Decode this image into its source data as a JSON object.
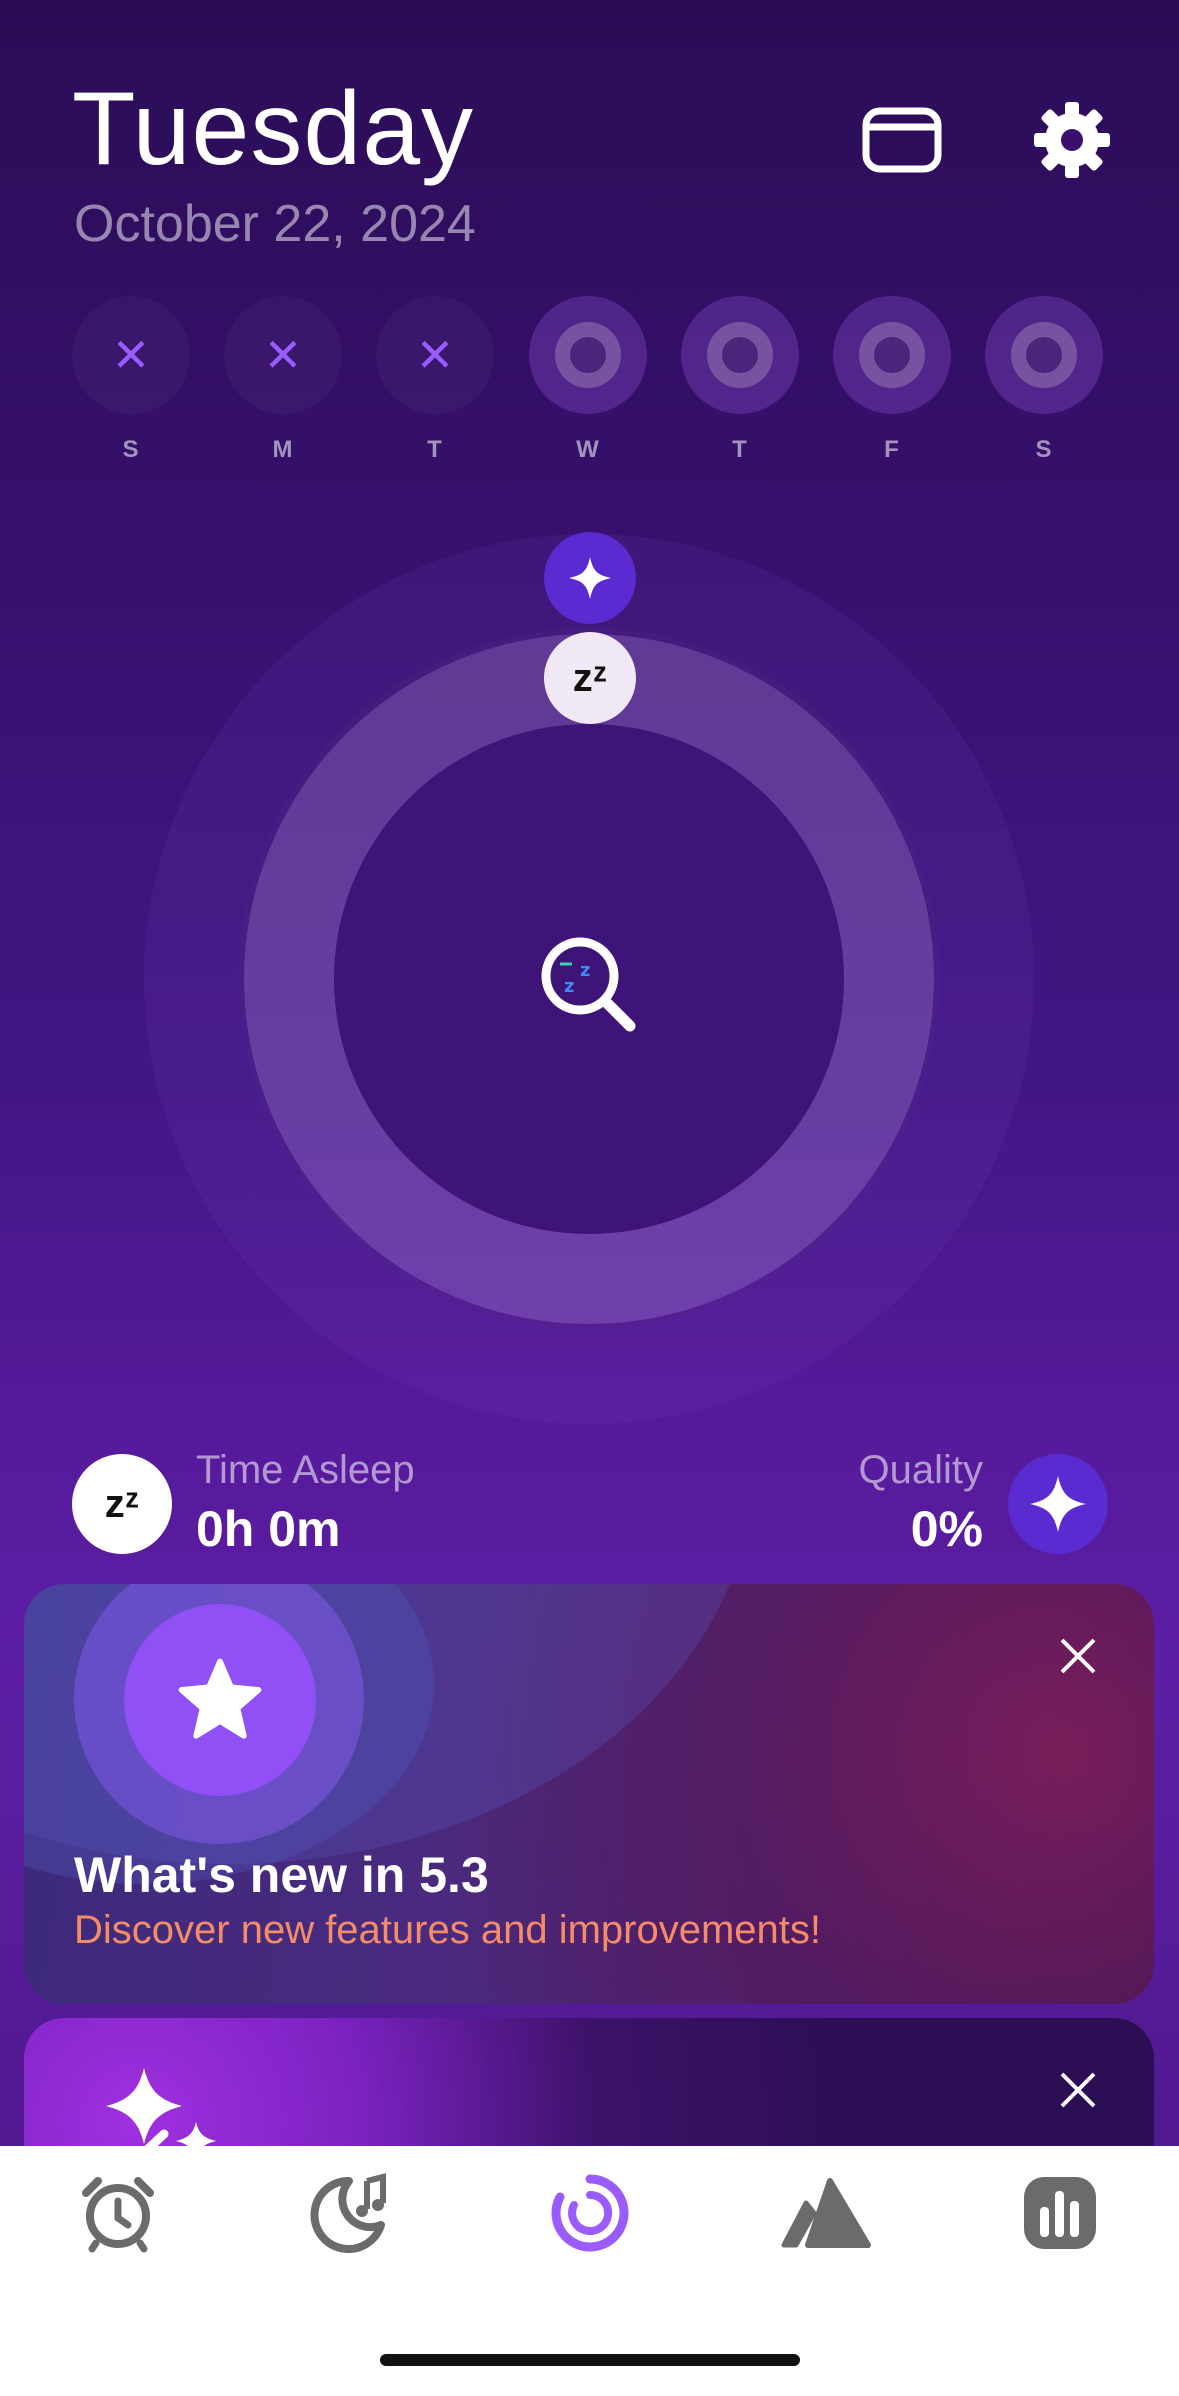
{
  "header": {
    "day": "Tuesday",
    "date": "October 22, 2024"
  },
  "week": {
    "days": [
      {
        "letter": "S",
        "state": "missed",
        "mark": "✕"
      },
      {
        "letter": "M",
        "state": "missed",
        "mark": "✕"
      },
      {
        "letter": "T",
        "state": "missed",
        "mark": "✕"
      },
      {
        "letter": "W",
        "state": "future",
        "mark": ""
      },
      {
        "letter": "T",
        "state": "future",
        "mark": ""
      },
      {
        "letter": "F",
        "state": "future",
        "mark": ""
      },
      {
        "letter": "S",
        "state": "future",
        "mark": ""
      }
    ]
  },
  "dial": {
    "sleep_badge": "zᶻ"
  },
  "stats": {
    "asleep_icon": "zᶻ",
    "asleep_label": "Time Asleep",
    "asleep_value": "0h 0m",
    "quality_label": "Quality",
    "quality_value": "0%"
  },
  "whats_new": {
    "title": "What's new in 5.3",
    "subtitle": "Discover new features and improvements!"
  },
  "icons": {
    "calendar": "calendar-icon",
    "settings": "gear-icon",
    "alarm": "alarm-clock-icon",
    "sounds": "moon-music-icon",
    "sleep": "sleep-progress-icon",
    "trends": "mountain-icon",
    "stats": "bar-chart-icon"
  },
  "colors": {
    "accent": "#9a5cff",
    "quality": "#5a2bd0",
    "subtitle": "#f48c68",
    "tab_active": "#9a5cff",
    "tab_inactive": "#6b6b6b"
  }
}
